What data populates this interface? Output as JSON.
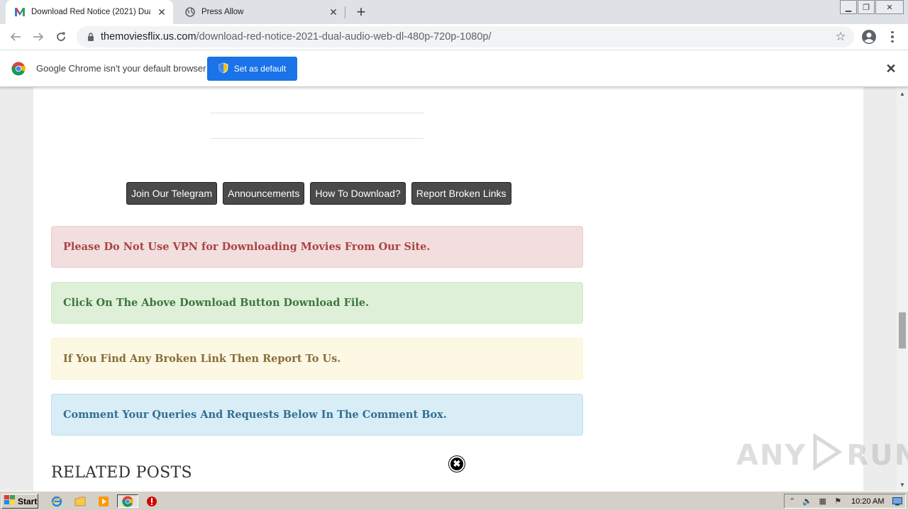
{
  "browser": {
    "tabs": [
      {
        "title": "Download Red Notice (2021) Dual Au",
        "favicon": "m-logo-icon",
        "active": true
      },
      {
        "title": "Press Allow",
        "favicon": "globe-icon",
        "active": false
      }
    ],
    "new_tab_label": "+",
    "url_host": "themoviesflix.us.com",
    "url_path": "/download-red-notice-2021-dual-audio-web-dl-480p-720p-1080p/"
  },
  "infobar": {
    "message": "Google Chrome isn't your default browser",
    "button_label": "Set as default"
  },
  "page": {
    "buttons": [
      "Join Our Telegram",
      "Announcements",
      "How To Download?",
      "Report Broken Links"
    ],
    "notices": {
      "danger": "Please Do Not Use VPN for Downloading Movies From Our Site.",
      "success": "Click On The Above Download Button Download File.",
      "warning": "If You Find Any Broken Link Then Report To Us.",
      "info": "Comment Your Queries And Requests Below In The Comment Box."
    },
    "related_heading": "RELATED POSTS",
    "close_ad_glyph": "✖"
  },
  "watermark": {
    "left": "ANY",
    "right": "RUN"
  },
  "taskbar": {
    "start_label": "Start",
    "clock": "10:20 AM"
  },
  "colors": {
    "danger_bg": "#f2dede",
    "success_bg": "#dff0d8",
    "warning_bg": "#fcf8e3",
    "info_bg": "#d9edf7",
    "accent_blue": "#1a73e8",
    "button_dark": "#4a4a4a"
  }
}
